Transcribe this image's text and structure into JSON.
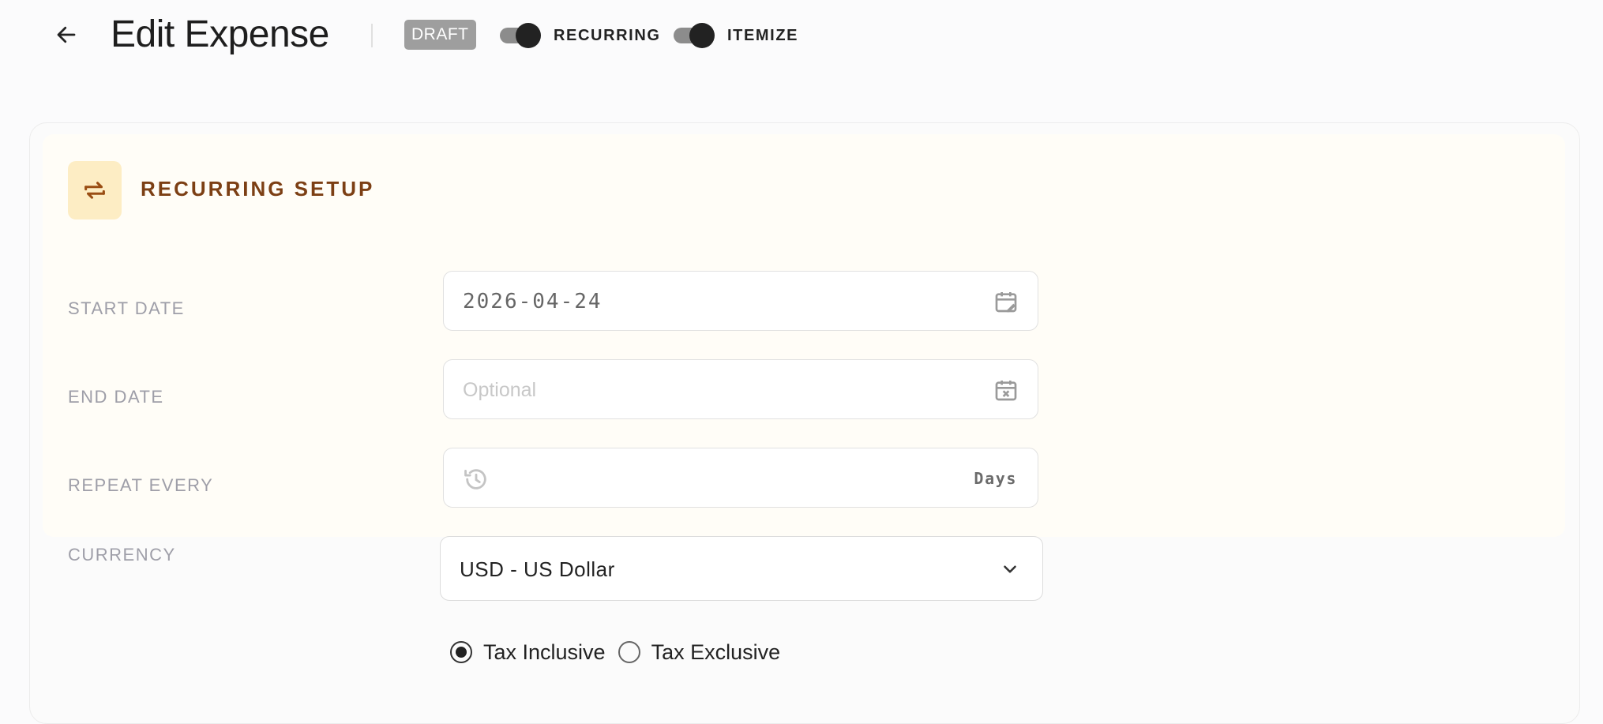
{
  "header": {
    "title": "Edit Expense",
    "status_badge": "DRAFT",
    "toggles": [
      {
        "label": "RECURRING",
        "on": true
      },
      {
        "label": "ITEMIZE",
        "on": true
      }
    ]
  },
  "section": {
    "title": "RECURRING SETUP",
    "icon": "repeat-icon"
  },
  "fields": {
    "start_date": {
      "label": "START DATE",
      "value": "2026-04-24",
      "icon": "calendar-edit-icon"
    },
    "end_date": {
      "label": "END DATE",
      "value": "",
      "placeholder": "Optional",
      "icon": "calendar-clear-icon"
    },
    "repeat_every": {
      "label": "REPEAT EVERY",
      "value": "",
      "suffix": "Days",
      "icon": "history-icon"
    },
    "currency": {
      "label": "CURRENCY",
      "value": "USD - US Dollar"
    }
  },
  "tax": {
    "options": [
      {
        "label": "Tax Inclusive",
        "selected": true
      },
      {
        "label": "Tax Exclusive",
        "selected": false
      }
    ]
  },
  "colors": {
    "accent_text": "#7c3f14",
    "icon_bg": "#fdedc4",
    "badge_bg": "#9e9e9e"
  }
}
